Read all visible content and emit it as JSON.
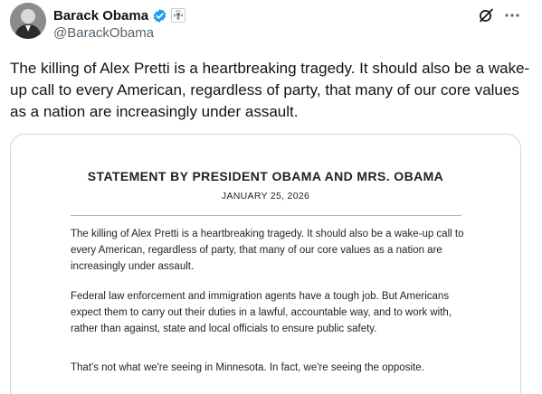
{
  "author": {
    "display_name": "Barack Obama",
    "handle": "@BarackObama",
    "verified": true,
    "affiliation_badge": "government-seal-icon"
  },
  "tweet": {
    "text": "The killing of Alex Pretti is a heartbreaking tragedy. It should also be a wake-up call to every American, regardless of party, that many of our core values as a nation are increasingly under assault."
  },
  "actions": {
    "grok_icon": "grok-icon",
    "more_icon": "more-options-icon"
  },
  "statement": {
    "title": "STATEMENT BY PRESIDENT OBAMA AND MRS. OBAMA",
    "date": "JANUARY 25, 2026",
    "paragraphs": [
      "The killing of Alex Pretti is a heartbreaking tragedy. It should also be a wake-up call to every American, regardless of party, that many of our core values as a nation are increasingly under assault.",
      "Federal law enforcement and immigration agents have a tough job. But Americans expect them to carry out their duties in a lawful, accountable way, and to work with, rather than against, state and local officials to ensure public safety.",
      "That's not what we're seeing in Minnesota. In fact, we're seeing the opposite."
    ]
  },
  "colors": {
    "verified": "#1d9bf0",
    "secondary_text": "#536471",
    "border": "#cfd9de"
  }
}
